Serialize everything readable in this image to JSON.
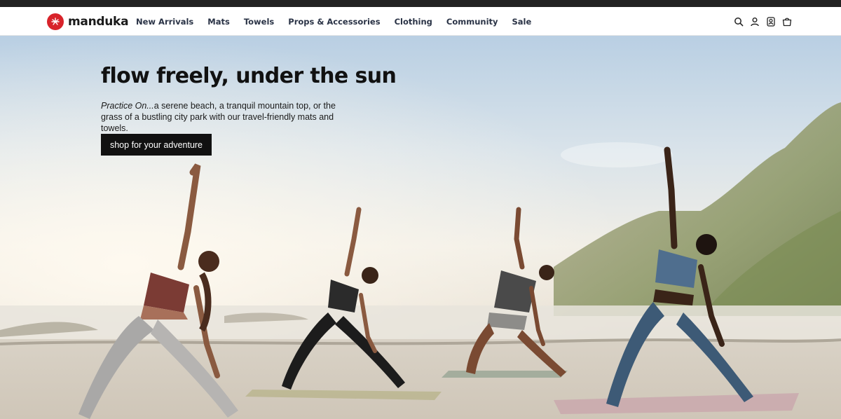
{
  "brand": {
    "name": "manduka",
    "logo_icon": "manduka-logo-icon",
    "accent": "#d8232a"
  },
  "nav": {
    "items": [
      {
        "label": "New Arrivals"
      },
      {
        "label": "Mats"
      },
      {
        "label": "Towels"
      },
      {
        "label": "Props & Accessories"
      },
      {
        "label": "Clothing"
      },
      {
        "label": "Community"
      },
      {
        "label": "Sale"
      }
    ]
  },
  "header_icons": [
    "search-icon",
    "account-icon",
    "location-icon",
    "cart-icon"
  ],
  "hero": {
    "title": "flow freely, under the sun",
    "text_em": "Practice On...",
    "text_rest": "a serene beach, a tranquil mountain top, or the grass of a bustling city park with our travel-friendly mats and towels.",
    "cta_label": "shop for your adventure"
  }
}
